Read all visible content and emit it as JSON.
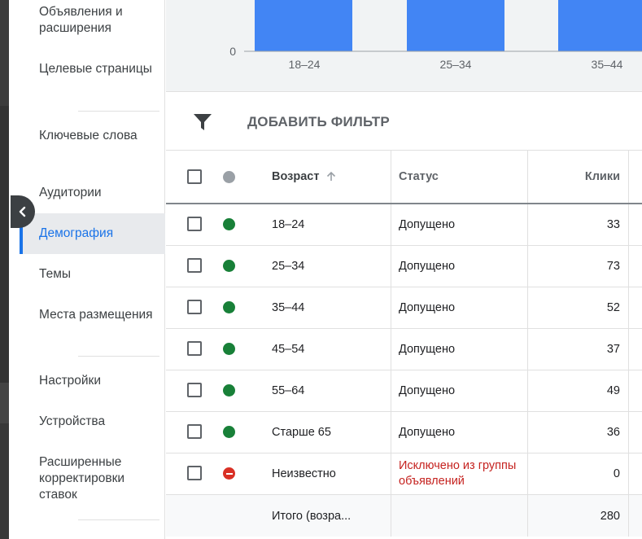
{
  "sidebar": {
    "items": [
      {
        "label": "Объявления и расширения"
      },
      {
        "label": "Целевые страницы"
      },
      {
        "label": "Ключевые слова"
      },
      {
        "label": "Аудитории"
      },
      {
        "label": "Демография",
        "active": true
      },
      {
        "label": "Темы"
      },
      {
        "label": "Места размещения"
      },
      {
        "label": "Настройки"
      },
      {
        "label": "Устройства"
      },
      {
        "label": "Расширенные корректировки ставок"
      }
    ]
  },
  "chart_data": {
    "type": "bar",
    "categories": [
      "18–24",
      "25–34",
      "35–44"
    ],
    "y_tick_label": "0",
    "bar_color": "#4285f4"
  },
  "filter": {
    "label": "ДОБАВИТЬ ФИЛЬТР",
    "icon": "filter-icon"
  },
  "table": {
    "headers": {
      "age": "Возраст",
      "status": "Статус",
      "clicks": "Клики",
      "sort_icon": "arrow-up-icon"
    },
    "rows": [
      {
        "age": "18–24",
        "status": "Допущено",
        "clicks": "33",
        "state": "enabled"
      },
      {
        "age": "25–34",
        "status": "Допущено",
        "clicks": "73",
        "state": "enabled"
      },
      {
        "age": "35–44",
        "status": "Допущено",
        "clicks": "52",
        "state": "enabled"
      },
      {
        "age": "45–54",
        "status": "Допущено",
        "clicks": "37",
        "state": "enabled"
      },
      {
        "age": "55–64",
        "status": "Допущено",
        "clicks": "49",
        "state": "enabled"
      },
      {
        "age": "Старше 65",
        "status": "Допущено",
        "clicks": "36",
        "state": "enabled"
      },
      {
        "age": "Неизвестно",
        "status": "Исключено из группы объявлений",
        "clicks": "0",
        "state": "excluded"
      }
    ],
    "total": {
      "label": "Итого (возра...",
      "clicks": "280"
    }
  },
  "colors": {
    "accent": "#1a73e8",
    "enabled": "#188038",
    "excluded": "#d93025",
    "bar": "#4285f4"
  }
}
